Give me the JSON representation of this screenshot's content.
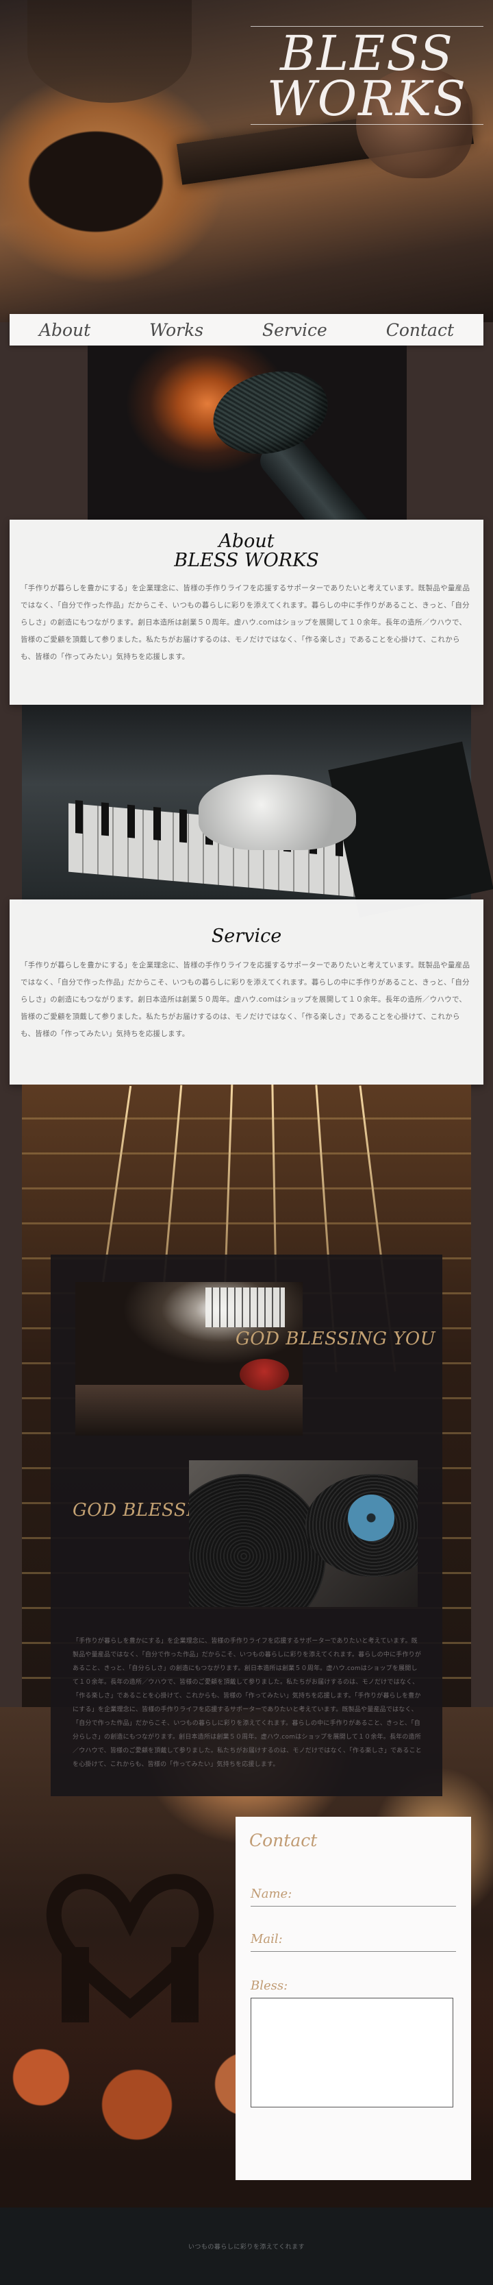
{
  "hero": {
    "title_line1": "BLESS",
    "title_line2": "WORKS"
  },
  "nav": {
    "about": "About",
    "works": "Works",
    "service": "Service",
    "contact": "Contact"
  },
  "about": {
    "heading_line1": "About",
    "heading_line2": "BLESS WORKS",
    "paragraph": "「手作りが暮らしを豊かにする」を企業理念に、皆様の手作りライフを応援するサポーターでありたいと考えています。既製品や量産品ではなく、「自分で作った作品」だからこそ、いつもの暮らしに彩りを添えてくれます。暮らしの中に手作りがあること、きっと、「自分らしさ」の創造にもつながります。創日本造所は創業５０周年。虚ハウ.comはショップを展開して１０余年。長年の造所／ウハウで、皆様のご愛顧を頂戴して参りました。私たちがお届けするのは、モノだけではなく、「作る楽しさ」であることを心掛けて、これからも、皆様の「作ってみたい」気持ちを応援します。"
  },
  "service": {
    "heading": "Service",
    "paragraph": "「手作りが暮らしを豊かにする」を企業理念に、皆様の手作りライフを応援するサポーターでありたいと考えています。既製品や量産品ではなく、「自分で作った作品」だからこそ、いつもの暮らしに彩りを添えてくれます。暮らしの中に手作りがあること、きっと、「自分らしさ」の創造にもつながります。創日本造所は創業５０周年。虚ハウ.comはショップを展開して１０余年。長年の造所／ウハウで、皆様のご愛顧を頂戴して参りました。私たちがお届けするのは、モノだけではなく、「作る楽しさ」であることを心掛けて、これからも、皆様の「作ってみたい」気持ちを応援します。"
  },
  "works": {
    "tagline_1": "GOD BLESSING YOU",
    "tagline_2": "GOD BLESSING YOU",
    "paragraph": "「手作りが暮らしを豊かにする」を企業理念に、皆様の手作りライフを応援するサポーターでありたいと考えています。既製品や量産品ではなく、「自分で作った作品」だからこそ、いつもの暮らしに彩りを添えてくれます。暮らしの中に手作りがあること、きっと、「自分らしさ」の創造にもつながります。創日本造所は創業５０周年。虚ハウ.comはショップを展開して１０余年。長年の造所／ウハウで、皆様のご愛顧を頂戴して参りました。私たちがお届けするのは、モノだけではなく、「作る楽しさ」であることを心掛けて、これからも、皆様の「作ってみたい」気持ちを応援します。「手作りが暮らしを豊かにする」を企業理念に、皆様の手作りライフを応援するサポーターでありたいと考えています。既製品や量産品ではなく、「自分で作った作品」だからこそ、いつもの暮らしに彩りを添えてくれます。暮らしの中に手作りがあること、きっと、「自分らしさ」の創造にもつながります。創日本造所は創業５０周年。虚ハウ.comはショップを展開して１０余年。長年の造所／ウハウで、皆様のご愛顧を頂戴して参りました。私たちがお届けするのは、モノだけではなく、「作る楽しさ」であることを心掛けて、これからも、皆様の「作ってみたい」気持ちを応援します。"
  },
  "contact": {
    "heading": "Contact",
    "name_label": "Name:",
    "mail_label": "Mail:",
    "message_label": "Bless:"
  },
  "footer": {
    "text": "いつもの暮らしに彩りを添えてくれます"
  },
  "colors": {
    "accent_gold": "#c09b73",
    "page_bg": "#3b2f2c",
    "footer_bg": "#171a1c"
  }
}
